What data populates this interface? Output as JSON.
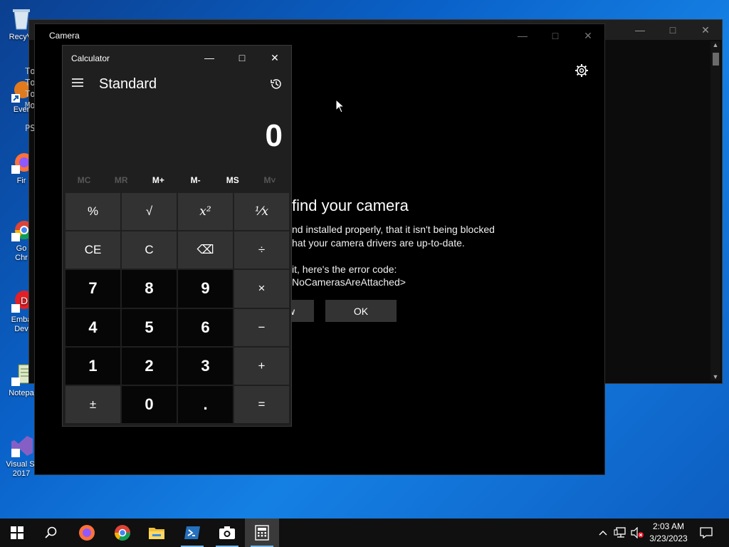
{
  "desktop": {
    "icons": [
      {
        "label": "RecyVi",
        "icon": "recycle-bin-icon"
      },
      {
        "label": "Ever",
        "icon": "shortcut-icon"
      },
      {
        "label": "Fir",
        "icon": "firefox-icon"
      },
      {
        "label": "Go\nChr",
        "icon": "chrome-icon"
      },
      {
        "label": "Emba\nDev",
        "icon": "embarcadero-icon"
      },
      {
        "label": "Notepa",
        "icon": "notepad-icon"
      },
      {
        "label": "Visual St\n2017",
        "icon": "visual-studio-icon"
      }
    ],
    "partial_text": [
      "To",
      "To",
      "To",
      "Mo",
      "PS"
    ]
  },
  "camera_window": {
    "title": "Camera",
    "heading": "find your camera",
    "lines": [
      "nd installed properly, that it isn't being blocked",
      "hat your camera drivers are up-to-date.",
      "it, here's the error code:",
      "NoCamerasAreAttached>"
    ],
    "button_left": "ow",
    "button_ok": "OK"
  },
  "calculator": {
    "title": "Calculator",
    "mode": "Standard",
    "display": "0",
    "memory": [
      {
        "label": "MC",
        "enabled": false
      },
      {
        "label": "MR",
        "enabled": false
      },
      {
        "label": "M+",
        "enabled": true
      },
      {
        "label": "M-",
        "enabled": true
      },
      {
        "label": "MS",
        "enabled": true
      },
      {
        "label": "M˅",
        "enabled": false
      }
    ],
    "keys": [
      {
        "label": "%",
        "type": "op",
        "name": "percent-key"
      },
      {
        "label": "√",
        "type": "op",
        "name": "square-root-key"
      },
      {
        "label": "x²",
        "type": "sym",
        "name": "square-key"
      },
      {
        "label": "¹⁄x",
        "type": "sym",
        "name": "reciprocal-key"
      },
      {
        "label": "CE",
        "type": "op",
        "name": "clear-entry-key"
      },
      {
        "label": "C",
        "type": "op",
        "name": "clear-key"
      },
      {
        "label": "⌫",
        "type": "op",
        "name": "backspace-key"
      },
      {
        "label": "÷",
        "type": "op",
        "name": "divide-key"
      },
      {
        "label": "7",
        "type": "num",
        "name": "digit-7-key"
      },
      {
        "label": "8",
        "type": "num",
        "name": "digit-8-key"
      },
      {
        "label": "9",
        "type": "num",
        "name": "digit-9-key"
      },
      {
        "label": "×",
        "type": "op",
        "name": "multiply-key"
      },
      {
        "label": "4",
        "type": "num",
        "name": "digit-4-key"
      },
      {
        "label": "5",
        "type": "num",
        "name": "digit-5-key"
      },
      {
        "label": "6",
        "type": "num",
        "name": "digit-6-key"
      },
      {
        "label": "−",
        "type": "op",
        "name": "subtract-key"
      },
      {
        "label": "1",
        "type": "num",
        "name": "digit-1-key"
      },
      {
        "label": "2",
        "type": "num",
        "name": "digit-2-key"
      },
      {
        "label": "3",
        "type": "num",
        "name": "digit-3-key"
      },
      {
        "label": "+",
        "type": "op",
        "name": "add-key"
      },
      {
        "label": "±",
        "type": "op",
        "name": "negate-key"
      },
      {
        "label": "0",
        "type": "num",
        "name": "digit-0-key"
      },
      {
        "label": ".",
        "type": "num",
        "name": "decimal-key"
      },
      {
        "label": "=",
        "type": "op",
        "name": "equals-key"
      }
    ]
  },
  "taskbar": {
    "apps": [
      "start-icon",
      "search-icon",
      "firefox-icon",
      "chrome-icon",
      "file-explorer-icon",
      "powershell-icon",
      "camera-icon",
      "calculator-icon"
    ],
    "active_app": "calculator-icon",
    "time": "2:03 AM",
    "date": "3/23/2023"
  },
  "colors": {
    "accent": "#76b9ed",
    "calc_bg": "#1f1f1f",
    "key_num": "#060606",
    "key_op": "#323232"
  }
}
